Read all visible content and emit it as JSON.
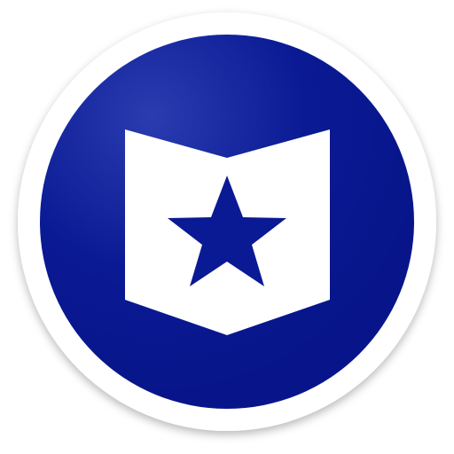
{
  "icon": {
    "name": "bookmark-star-app-icon",
    "shape": "circle-badge",
    "symbol": "open-book-with-star",
    "colors": {
      "ring": "#ffffff",
      "disc": "#0a1a94",
      "disc_highlight": "#2a3cb0",
      "book": "#ffffff",
      "star": "#0a1a94"
    }
  }
}
